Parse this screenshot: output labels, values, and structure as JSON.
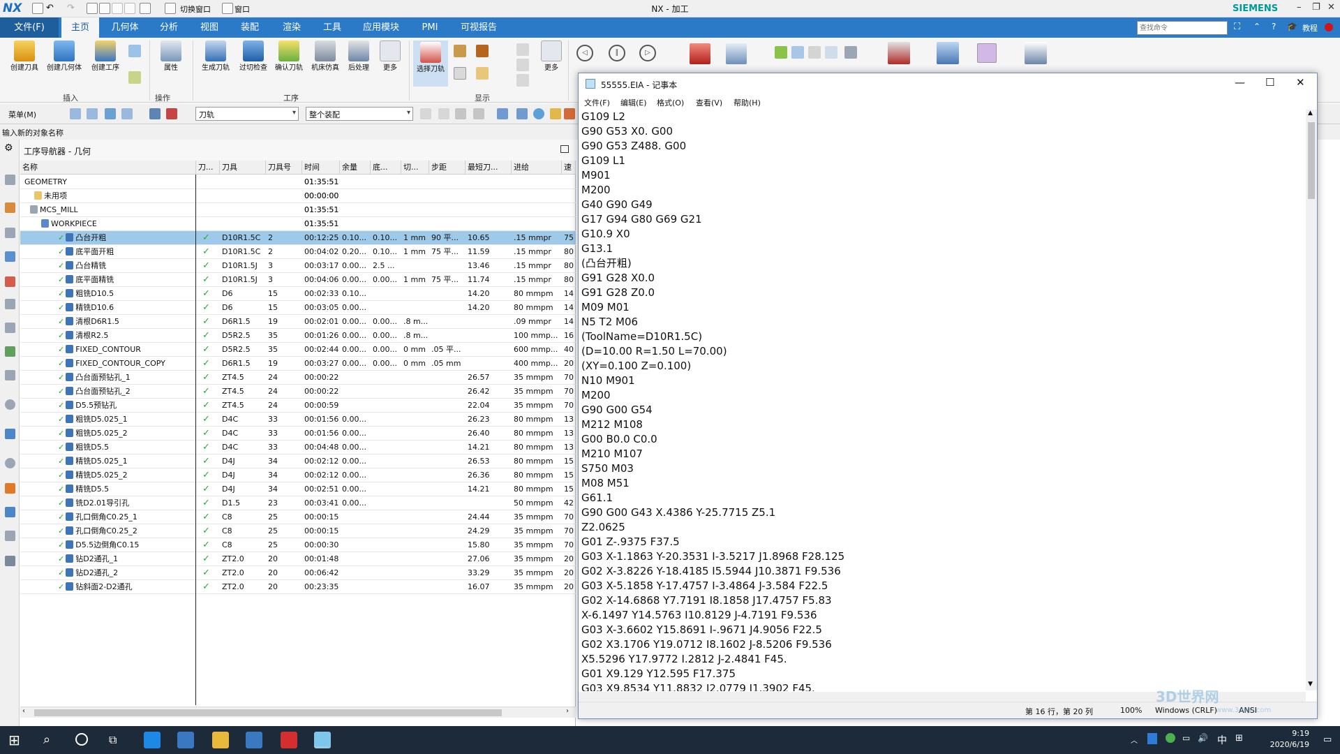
{
  "titlebar": {
    "logo": "NX",
    "title": "NX - 加工",
    "brand": "SIEMENS",
    "quick_switch": "切换窗口",
    "quick_window": "窗口"
  },
  "ribbon": {
    "file_tab": "文件(F)",
    "tabs": [
      "主页",
      "几何体",
      "分析",
      "视图",
      "装配",
      "渲染",
      "工具",
      "应用模块",
      "PMI",
      "可视报告"
    ],
    "search_placeholder": "查找命令",
    "tutorial": "教程",
    "buttons": [
      "创建刀具",
      "创建几何体",
      "创建工序",
      "属性",
      "生成刀轨",
      "过切检查",
      "确认刀轨",
      "机床仿真",
      "后处理",
      "更多",
      "选择刀轨",
      "更多"
    ],
    "groups": {
      "insert": "插入",
      "operation": "操作",
      "process": "工序",
      "display": "显示"
    }
  },
  "toolbar2": {
    "menu": "菜单(M)",
    "filter1": "刀轨",
    "filter2": "整个装配"
  },
  "prompt": "输入新的对象名称",
  "navigator": {
    "title": "工序导航器 - 几何",
    "columns": [
      "名称",
      "刀...",
      "刀具",
      "刀具号",
      "时间",
      "余量",
      "底...",
      "切...",
      "步距",
      "最短刀...",
      "进给",
      "速"
    ],
    "rows": [
      {
        "name": "GEOMETRY",
        "time": "01:35:51"
      },
      {
        "name": "未用项",
        "time": "00:00:00"
      },
      {
        "name": "MCS_MILL",
        "time": "01:35:51"
      },
      {
        "name": "WORKPIECE",
        "time": "01:35:51"
      },
      {
        "name": "凸台开粗",
        "tool": "D10R1.5C",
        "num": "2",
        "time": "00:12:25",
        "stock": "0.10...",
        "floor": "0.10...",
        "cut": "1 mm",
        "step": "90 平...",
        "min": "10.65",
        "feed": ".15 mmpr",
        "speed": "75"
      },
      {
        "name": "底平面开粗",
        "tool": "D10R1.5C",
        "num": "2",
        "time": "00:04:02",
        "stock": "0.20...",
        "floor": "0.10...",
        "cut": "1 mm",
        "step": "75 平...",
        "min": "11.59",
        "feed": ".15 mmpr",
        "speed": "80"
      },
      {
        "name": "凸台精铣",
        "tool": "D10R1.5J",
        "num": "3",
        "time": "00:03:17",
        "stock": "0.00...",
        "floor": "2.5 ...",
        "cut": "",
        "step": "",
        "min": "13.46",
        "feed": ".15 mmpr",
        "speed": "80"
      },
      {
        "name": "底平面精铣",
        "tool": "D10R1.5J",
        "num": "3",
        "time": "00:04:06",
        "stock": "0.00...",
        "floor": "0.00...",
        "cut": "1 mm",
        "step": "75 平...",
        "min": "11.74",
        "feed": ".15 mmpr",
        "speed": "80"
      },
      {
        "name": "粗铣D10.5",
        "tool": "D6",
        "num": "15",
        "time": "00:02:33",
        "stock": "0.10...",
        "floor": "",
        "cut": "",
        "step": "",
        "min": "14.20",
        "feed": "80 mmpm",
        "speed": "14"
      },
      {
        "name": "精铣D10.6",
        "tool": "D6",
        "num": "15",
        "time": "00:03:05",
        "stock": "0.00...",
        "floor": "",
        "cut": "",
        "step": "",
        "min": "14.20",
        "feed": "80 mmpm",
        "speed": "14"
      },
      {
        "name": "清根D6R1.5",
        "tool": "D6R1.5",
        "num": "19",
        "time": "00:02:01",
        "stock": "0.00...",
        "floor": "0.00...",
        "cut": ".8 m...",
        "step": "",
        "min": "",
        "feed": ".09 mmpr",
        "speed": "14"
      },
      {
        "name": "清根R2.5",
        "tool": "D5R2.5",
        "num": "35",
        "time": "00:01:26",
        "stock": "0.00...",
        "floor": "0.00...",
        "cut": ".8 m...",
        "step": "",
        "min": "",
        "feed": "100 mmp...",
        "speed": "16"
      },
      {
        "name": "FIXED_CONTOUR",
        "tool": "D5R2.5",
        "num": "35",
        "time": "00:02:44",
        "stock": "0.00...",
        "floor": "0.00...",
        "cut": "0 mm",
        "step": ".05 平...",
        "min": "",
        "feed": "600 mmp...",
        "speed": "40"
      },
      {
        "name": "FIXED_CONTOUR_COPY",
        "tool": "D6R1.5",
        "num": "19",
        "time": "00:03:27",
        "stock": "0.00...",
        "floor": "0.00...",
        "cut": "0 mm",
        "step": ".05 mm",
        "min": "",
        "feed": "400 mmp...",
        "speed": "20"
      },
      {
        "name": "凸台面预钻孔_1",
        "tool": "ZT4.5",
        "num": "24",
        "time": "00:00:22",
        "stock": "",
        "floor": "",
        "cut": "",
        "step": "",
        "min": "26.57",
        "feed": "35 mmpm",
        "speed": "70"
      },
      {
        "name": "凸台面预钻孔_2",
        "tool": "ZT4.5",
        "num": "24",
        "time": "00:00:22",
        "stock": "",
        "floor": "",
        "cut": "",
        "step": "",
        "min": "26.42",
        "feed": "35 mmpm",
        "speed": "70"
      },
      {
        "name": "D5.5预钻孔",
        "tool": "ZT4.5",
        "num": "24",
        "time": "00:00:59",
        "stock": "",
        "floor": "",
        "cut": "",
        "step": "",
        "min": "22.04",
        "feed": "35 mmpm",
        "speed": "70"
      },
      {
        "name": "粗铣D5.025_1",
        "tool": "D4C",
        "num": "33",
        "time": "00:01:56",
        "stock": "0.00...",
        "floor": "",
        "cut": "",
        "step": "",
        "min": "26.23",
        "feed": "80 mmpm",
        "speed": "13"
      },
      {
        "name": "粗铣D5.025_2",
        "tool": "D4C",
        "num": "33",
        "time": "00:01:56",
        "stock": "0.00...",
        "floor": "",
        "cut": "",
        "step": "",
        "min": "26.40",
        "feed": "80 mmpm",
        "speed": "13"
      },
      {
        "name": "粗铣D5.5",
        "tool": "D4C",
        "num": "33",
        "time": "00:04:48",
        "stock": "0.00...",
        "floor": "",
        "cut": "",
        "step": "",
        "min": "14.21",
        "feed": "80 mmpm",
        "speed": "13"
      },
      {
        "name": "精铣D5.025_1",
        "tool": "D4J",
        "num": "34",
        "time": "00:02:12",
        "stock": "0.00...",
        "floor": "",
        "cut": "",
        "step": "",
        "min": "26.53",
        "feed": "80 mmpm",
        "speed": "15"
      },
      {
        "name": "精铣D5.025_2",
        "tool": "D4J",
        "num": "34",
        "time": "00:02:12",
        "stock": "0.00...",
        "floor": "",
        "cut": "",
        "step": "",
        "min": "26.36",
        "feed": "80 mmpm",
        "speed": "15"
      },
      {
        "name": "精铣D5.5",
        "tool": "D4J",
        "num": "34",
        "time": "00:02:51",
        "stock": "0.00...",
        "floor": "",
        "cut": "",
        "step": "",
        "min": "14.21",
        "feed": "80 mmpm",
        "speed": "15"
      },
      {
        "name": "铣D2.01导引孔",
        "tool": "D1.5",
        "num": "23",
        "time": "00:03:41",
        "stock": "0.00...",
        "floor": "",
        "cut": "",
        "step": "",
        "min": "",
        "feed": "50 mmpm",
        "speed": "42"
      },
      {
        "name": "孔口倒角C0.25_1",
        "tool": "C8",
        "num": "25",
        "time": "00:00:15",
        "stock": "",
        "floor": "",
        "cut": "",
        "step": "",
        "min": "24.44",
        "feed": "35 mmpm",
        "speed": "70"
      },
      {
        "name": "孔口倒角C0.25_2",
        "tool": "C8",
        "num": "25",
        "time": "00:00:15",
        "stock": "",
        "floor": "",
        "cut": "",
        "step": "",
        "min": "24.29",
        "feed": "35 mmpm",
        "speed": "70"
      },
      {
        "name": "D5.5边倒角C0.15",
        "tool": "C8",
        "num": "25",
        "time": "00:00:30",
        "stock": "",
        "floor": "",
        "cut": "",
        "step": "",
        "min": "15.80",
        "feed": "35 mmpm",
        "speed": "70"
      },
      {
        "name": "钻D2通孔_1",
        "tool": "ZT2.0",
        "num": "20",
        "time": "00:01:48",
        "stock": "",
        "floor": "",
        "cut": "",
        "step": "",
        "min": "27.06",
        "feed": "35 mmpm",
        "speed": "20"
      },
      {
        "name": "钻D2通孔_2",
        "tool": "ZT2.0",
        "num": "20",
        "time": "00:06:42",
        "stock": "",
        "floor": "",
        "cut": "",
        "step": "",
        "min": "33.29",
        "feed": "35 mmpm",
        "speed": "20"
      },
      {
        "name": "钻斜面2-D2通孔",
        "tool": "ZT2.0",
        "num": "20",
        "time": "00:23:35",
        "stock": "",
        "floor": "",
        "cut": "",
        "step": "",
        "min": "16.07",
        "feed": "35 mmpm",
        "speed": "20"
      }
    ]
  },
  "notepad": {
    "title": "55555.EIA - 记事本",
    "menu": [
      "文件(F)",
      "编辑(E)",
      "格式(O)",
      "查看(V)",
      "帮助(H)"
    ],
    "lines": [
      "G109 L2",
      "G90 G53 X0. G00",
      "G90 G53 Z488. G00",
      "G109 L1",
      "M901",
      "M200",
      "G40 G90 G49",
      "G17 G94 G80 G69 G21",
      "G10.9 X0",
      "G13.1",
      "(凸台开粗)",
      "G91 G28 X0.0",
      "G91 G28 Z0.0",
      "M09 M01",
      "N5 T2 M06",
      "(ToolName=D10R1.5C)",
      "(D=10.00 R=1.50 L=70.00)",
      "(XY=0.100 Z=0.100)",
      "N10 M901",
      "M200",
      "G90 G00 G54",
      "M212 M108",
      "G00 B0.0 C0.0",
      "M210 M107",
      "S750 M03",
      "M08 M51",
      "G61.1",
      "G90 G00 G43 X.4386 Y-25.7715 Z5.1",
      "Z2.0625",
      "G01 Z-.9375 F37.5",
      "G03 X-1.1863 Y-20.3531 I-3.5217 J1.8968 F28.125",
      "G02 X-3.8226 Y-18.4185 I5.5944 J10.3871 F9.536",
      "G03 X-5.1858 Y-17.4757 I-3.4864 J-3.584 F22.5",
      "G02 X-14.6868 Y7.7191 I8.1858 J17.4757 F5.83",
      "X-6.1497 Y14.5763 I10.8129 J-4.7191 F9.536",
      "G03 X-3.6602 Y15.8691 I-.9671 J4.9056 F22.5",
      "G02 X3.1706 Y19.0712 I8.1602 J-8.5206 F9.536",
      "X5.5296 Y17.9772 I.2812 J-2.4841 F45.",
      "G01 X9.129 Y12.595 F17.375",
      "G03 X9.8534 Y11.8832 I2.0779 J1.3902 F45."
    ],
    "status": {
      "position": "第 16 行，第 20 列",
      "zoom": "100%",
      "eol": "Windows (CRLF)",
      "encoding": "ANSI"
    }
  },
  "taskbar": {
    "time": "9:19",
    "date": "2020/6/19",
    "ime": "中"
  },
  "watermark": {
    "main": "3D世界网",
    "sub": "www.3dsjw.com"
  }
}
